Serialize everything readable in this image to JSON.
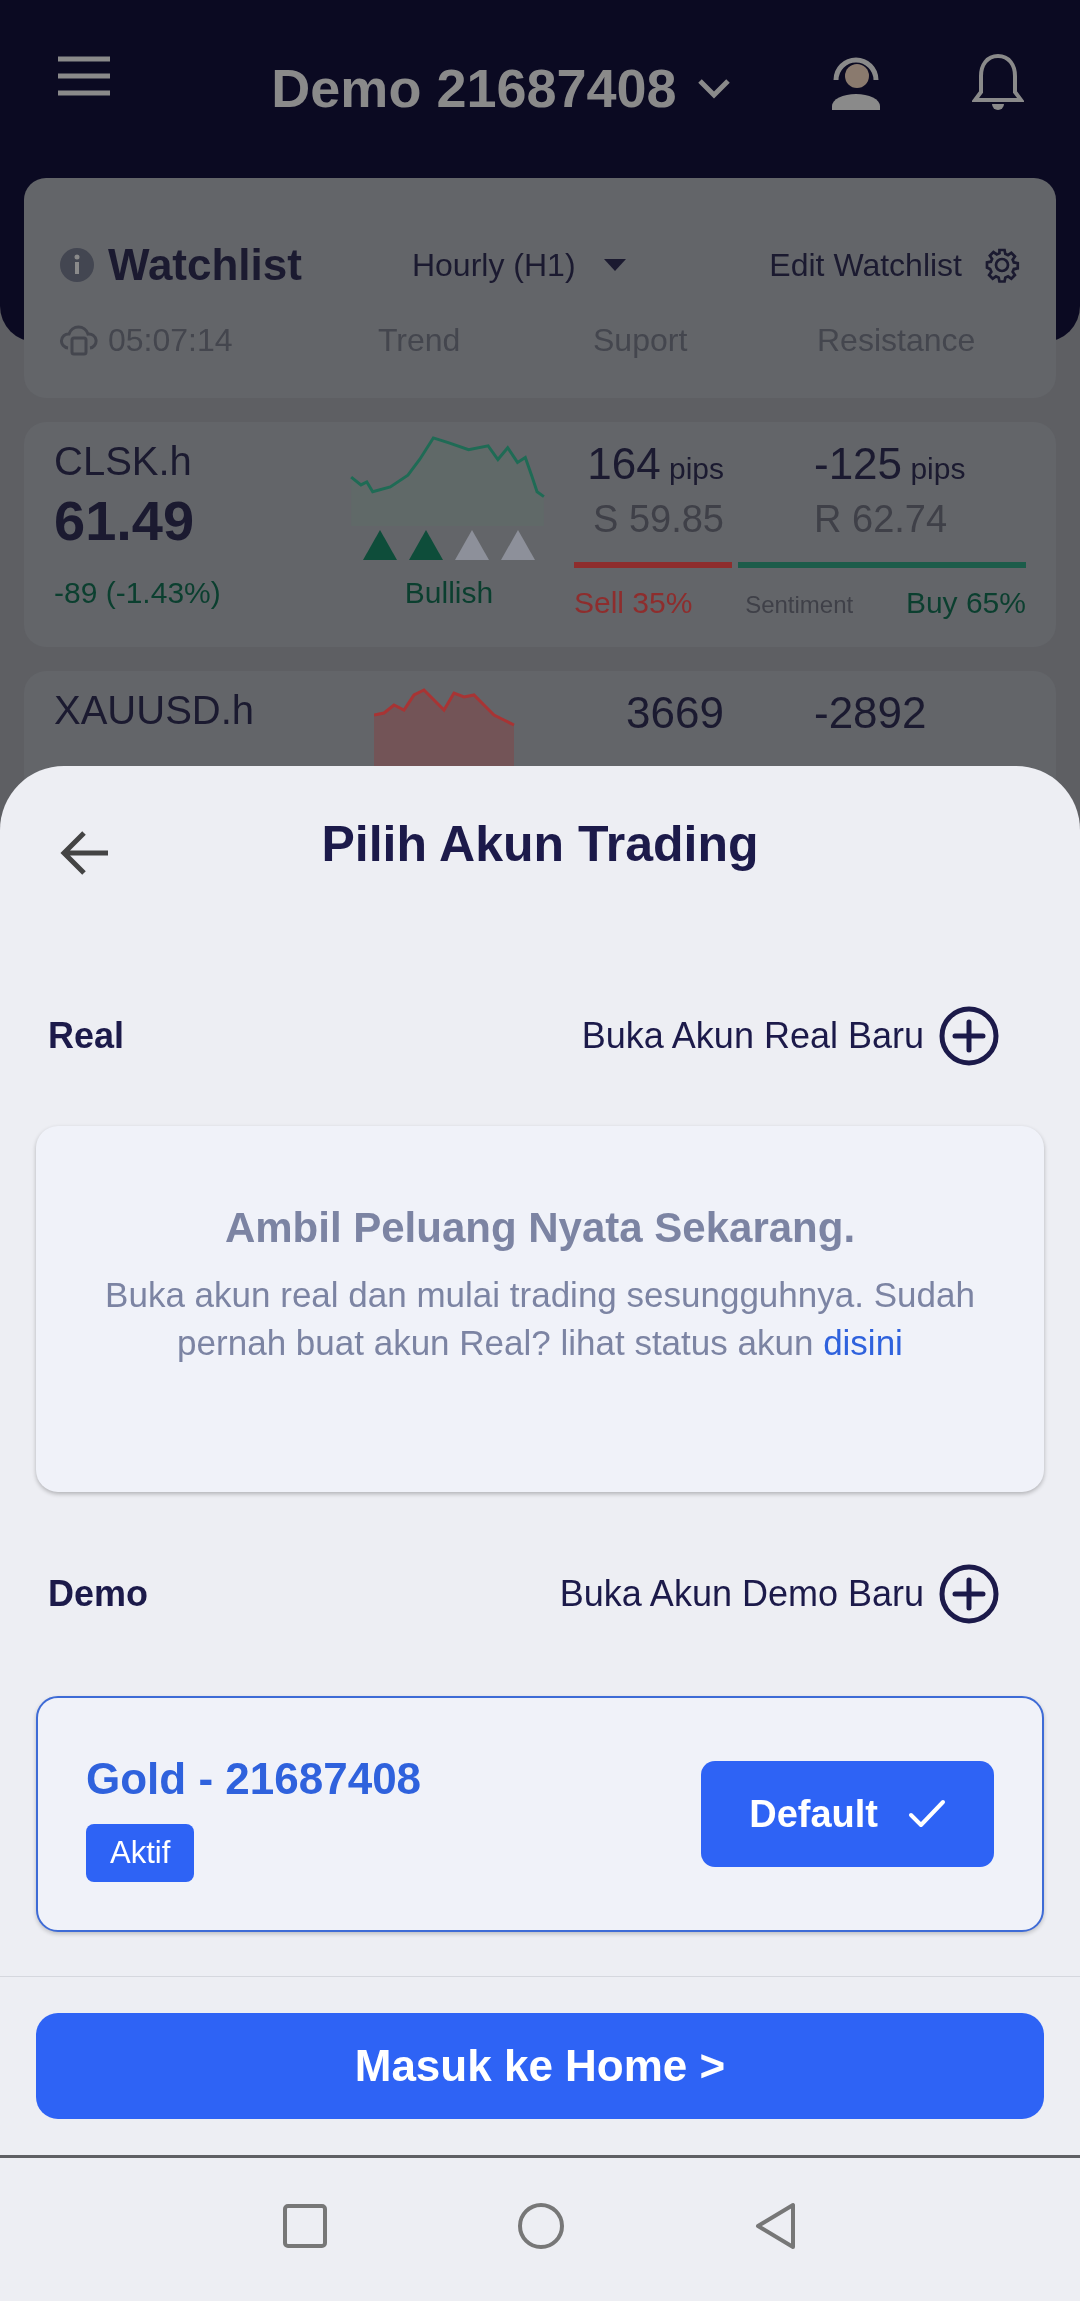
{
  "header": {
    "account": "Demo 21687408"
  },
  "watchlist": {
    "title": "Watchlist",
    "timeframe": "Hourly (H1)",
    "edit": "Edit Watchlist",
    "time": "05:07:14",
    "columns": [
      "Trend",
      "Suport",
      "Resistance"
    ]
  },
  "instruments": [
    {
      "symbol": "CLSK.h",
      "price": "61.49",
      "change": "-89 (-1.43%)",
      "color": "#1f6b55",
      "stars": 2,
      "trend": "Bullish",
      "support_pips": "164",
      "support_unit": "pips",
      "resistance_pips": "-125",
      "resistance_unit": "pips",
      "support": "S 59.85",
      "resistance": "R 62.74",
      "sell": "Sell 35%",
      "sentiment": "Sentiment",
      "buy": "Buy 65%",
      "level": 0.35
    },
    {
      "symbol": "XAUUSD.h",
      "color": "#a83434",
      "support_pips": "3669",
      "resistance_pips": "-2892"
    }
  ],
  "sheet": {
    "title": "Pilih Akun Trading",
    "sections": [
      {
        "kind": "promo",
        "label": "Real",
        "action": "Buka Akun Real Baru",
        "promo_title": "Ambil Peluang Nyata Sekarang.",
        "promo_text": "Buka akun real dan mulai trading sesungguhnya. Sudah pernah buat akun Real? lihat status akun",
        "promo_link": "disini"
      },
      {
        "kind": "accounts",
        "label": "Demo",
        "action": "Buka Akun Demo Baru",
        "accounts": [
          {
            "name": "Gold - 21687408",
            "badge": "Aktif",
            "button": "Default",
            "selected": true
          }
        ]
      }
    ],
    "primary_button": "Masuk ke Home >"
  }
}
